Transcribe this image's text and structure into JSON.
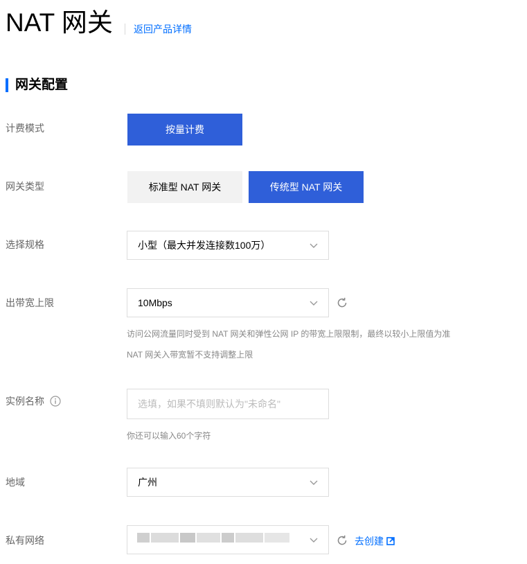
{
  "header": {
    "title": "NAT 网关",
    "back_link": "返回产品详情"
  },
  "section": {
    "title": "网关配置"
  },
  "billing": {
    "label": "计费模式",
    "option": "按量计费"
  },
  "gateway_type": {
    "label": "网关类型",
    "options": [
      "标准型 NAT 网关",
      "传统型 NAT 网关"
    ],
    "selected": "传统型 NAT 网关"
  },
  "spec": {
    "label": "选择规格",
    "value": "小型（最大并发连接数100万）"
  },
  "bandwidth": {
    "label": "出带宽上限",
    "value": "10Mbps",
    "help1": "访问公网流量同时受到 NAT 网关和弹性公网 IP 的带宽上限限制，最终以较小上限值为准",
    "help2": "NAT 网关入带宽暂不支持调整上限"
  },
  "instance_name": {
    "label": "实例名称",
    "placeholder": "选填，如果不填则默认为\"未命名\"",
    "value": "",
    "help": "你还可以输入60个字符"
  },
  "region": {
    "label": "地域",
    "value": "广州"
  },
  "vpc": {
    "label": "私有网络",
    "create_link": "去创建"
  },
  "colors": {
    "primary": "#2f5fd9",
    "link": "#006eff",
    "label": "#666666",
    "border": "#dddddd"
  }
}
